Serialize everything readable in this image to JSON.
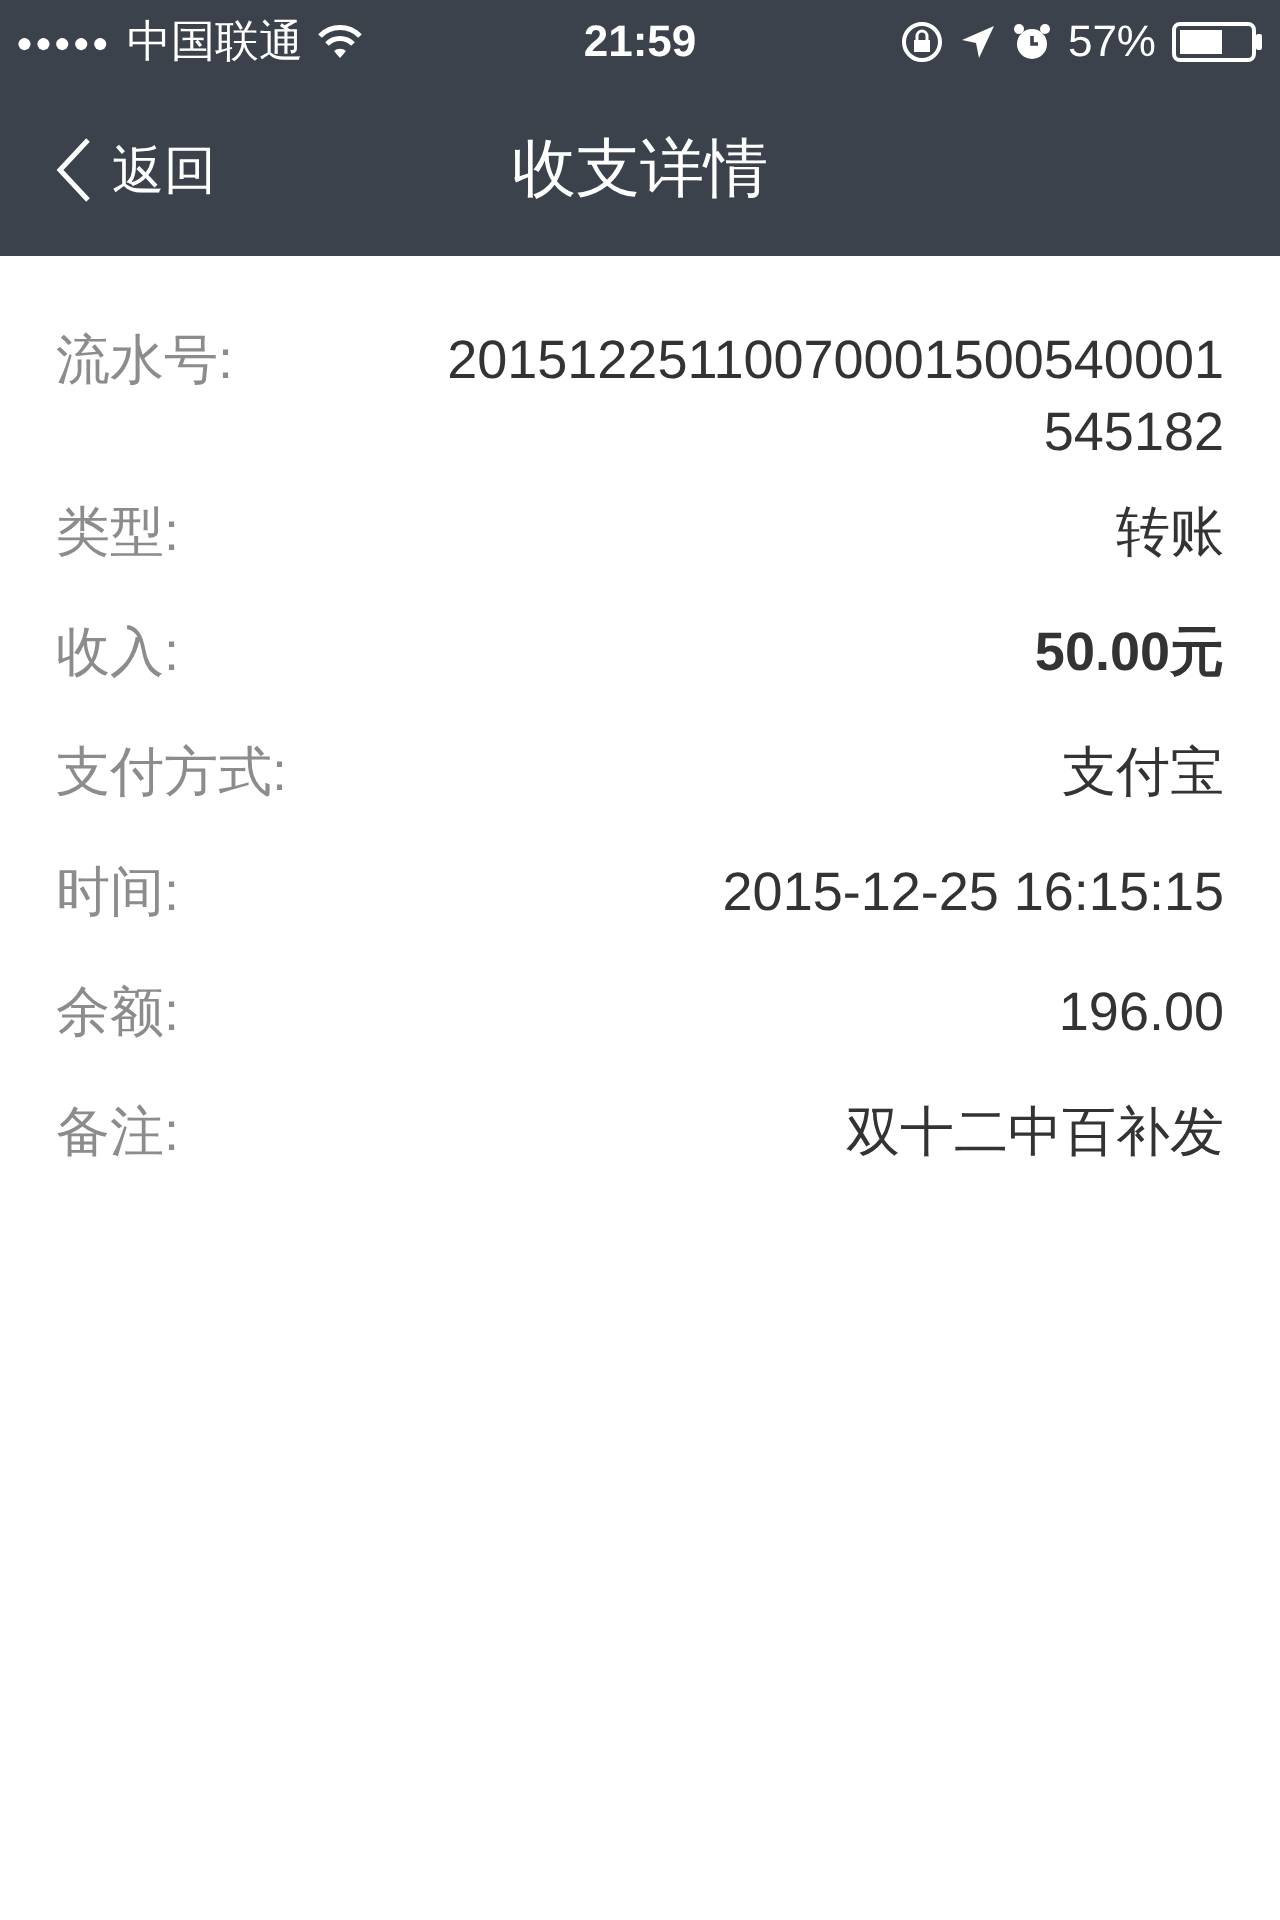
{
  "status_bar": {
    "signal_dots": "●●●●●",
    "carrier": "中国联通",
    "time": "21:59",
    "battery": "57%"
  },
  "nav": {
    "back": "返回",
    "title": "收支详情"
  },
  "rows": [
    {
      "label": "流水号:",
      "value": "20151225110070001500540001545182",
      "bold": false
    },
    {
      "label": "类型:",
      "value": "转账",
      "bold": false
    },
    {
      "label": "收入:",
      "value": "50.00元",
      "bold": true
    },
    {
      "label": "支付方式:",
      "value": "支付宝",
      "bold": false
    },
    {
      "label": "时间:",
      "value": "2015-12-25 16:15:15",
      "bold": false
    },
    {
      "label": "余额:",
      "value": "196.00",
      "bold": false
    },
    {
      "label": "备注:",
      "value": "双十二中百补发",
      "bold": false
    }
  ]
}
